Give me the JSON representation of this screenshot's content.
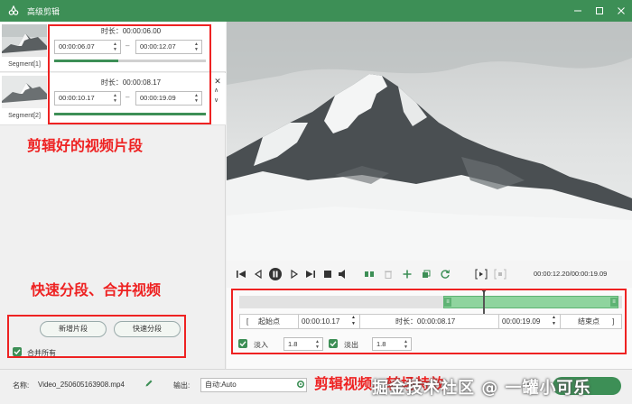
{
  "window": {
    "title": "高级剪辑"
  },
  "segments": [
    {
      "label": "Segment[1]",
      "duration": "时长：00:00:06.00",
      "start": "00:00:06.07",
      "end": "00:00:12.07",
      "progress": 0.42
    },
    {
      "label": "Segment[2]",
      "duration": "时长：00:00:08.17",
      "start": "00:00:10.17",
      "end": "00:00:19.09",
      "progress": 1.0
    }
  ],
  "segment_dash": "–",
  "annotations": {
    "clipped_segments": "剪辑好的视频片段",
    "split_merge": "快速分段、合并视频",
    "clip_effects": "剪辑视频、转场特效"
  },
  "left_buttons": {
    "add_segment": "新增片段",
    "quick_split": "快速分段",
    "merge_all": "合并所有"
  },
  "player": {
    "time": "00:00:12.20/00:00:19.09"
  },
  "timeline": {
    "start_label": "起始点",
    "start_value": "00:00:10.17",
    "duration": "时长：00:00:08.17",
    "end_value": "00:00:19.09",
    "end_label": "结束点",
    "left_bracket": "[",
    "right_bracket": "]"
  },
  "fade": {
    "in_label": "淡入",
    "in_value": "1.8",
    "out_label": "淡出",
    "out_value": "1.8"
  },
  "bottom": {
    "name_label": "名称:",
    "name_value": "Video_250605163908.mp4",
    "output_label": "输出:",
    "output_value": "自动:Auto"
  },
  "watermark": "掘金技术社区 @ 一罐小可乐",
  "colors": {
    "accent": "#3d8f56",
    "annotation": "#ee2222",
    "selection": "#8fd49e"
  }
}
